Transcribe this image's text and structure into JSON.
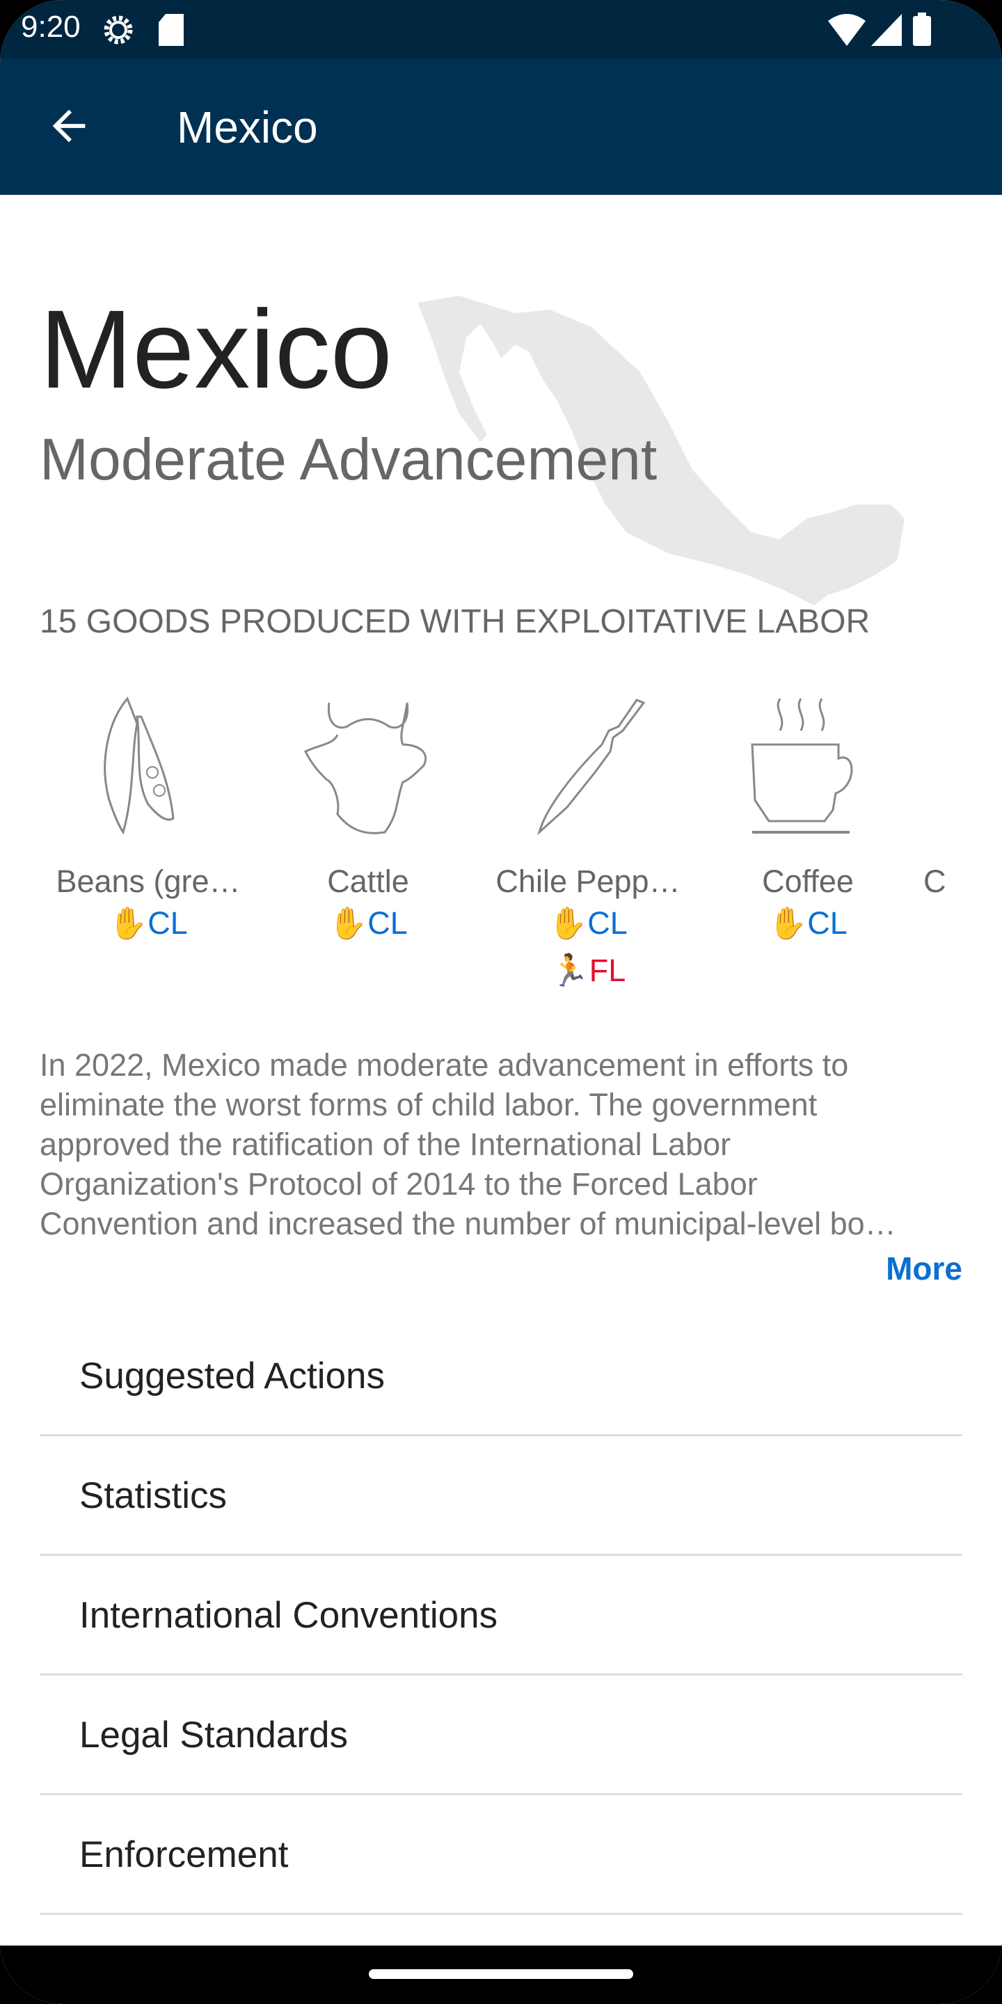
{
  "status_bar": {
    "time": "9:20",
    "icons": [
      "settings-gear-icon",
      "sd-card-icon",
      "wifi-icon",
      "signal-icon",
      "battery-icon"
    ]
  },
  "app_bar": {
    "title": "Mexico",
    "back_icon": "arrow-left-icon"
  },
  "country": {
    "name": "Mexico",
    "assessment": "Moderate Advancement"
  },
  "goods": {
    "heading": "15 GOODS PRODUCED WITH EXPLOITATIVE LABOR",
    "items": [
      {
        "label": "Beans (gre…",
        "icon": "bean-pod-icon",
        "tags": [
          "CL"
        ]
      },
      {
        "label": "Cattle",
        "icon": "cow-head-icon",
        "tags": [
          "CL"
        ]
      },
      {
        "label": "Chile Pepp…",
        "icon": "chile-pepper-icon",
        "tags": [
          "CL",
          "FL"
        ]
      },
      {
        "label": "Coffee",
        "icon": "coffee-cup-icon",
        "tags": [
          "CL"
        ]
      },
      {
        "label": "C",
        "icon": "",
        "tags": []
      }
    ],
    "tag_colors": {
      "CL": "#0a6fd1",
      "FL": "#e0102f"
    }
  },
  "summary": {
    "lines": [
      "In 2022, Mexico made moderate advancement in efforts to",
      "eliminate the worst forms of child labor. The government",
      "approved the ratification of the International Labor",
      "Organization's Protocol of 2014 to the Forced Labor",
      "Convention and increased the number of municipal-level bo…"
    ],
    "more_label": "More"
  },
  "sections": [
    "Suggested Actions",
    "Statistics",
    "International Conventions",
    "Legal Standards",
    "Enforcement"
  ],
  "colors": {
    "status_bar": "#012640",
    "app_bar": "#003152",
    "accent": "#0a6fd1"
  }
}
